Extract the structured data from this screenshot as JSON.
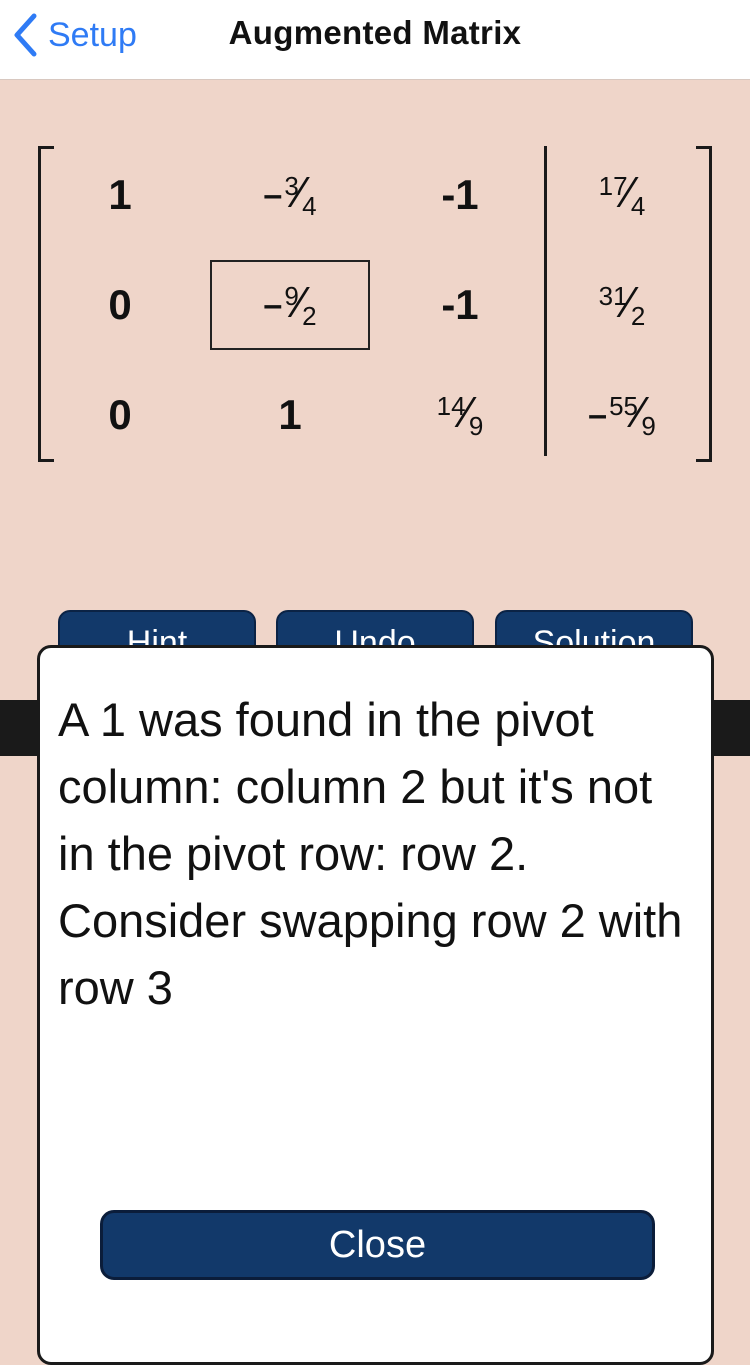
{
  "navbar": {
    "back_label": "Setup",
    "title": "Augmented Matrix"
  },
  "matrix": {
    "pivot_cell": {
      "row": 2,
      "col": 2
    },
    "rows": [
      [
        {
          "kind": "int",
          "text": "1"
        },
        {
          "kind": "frac",
          "neg": "-",
          "num": "3",
          "den": "4"
        },
        {
          "kind": "int",
          "text": "-1"
        },
        {
          "kind": "frac",
          "neg": "",
          "num": "17",
          "den": "4"
        }
      ],
      [
        {
          "kind": "int",
          "text": "0"
        },
        {
          "kind": "frac",
          "neg": "-",
          "num": "9",
          "den": "2"
        },
        {
          "kind": "int",
          "text": "-1"
        },
        {
          "kind": "frac",
          "neg": "",
          "num": "31",
          "den": "2"
        }
      ],
      [
        {
          "kind": "int",
          "text": "0"
        },
        {
          "kind": "int",
          "text": "1"
        },
        {
          "kind": "frac",
          "neg": "",
          "num": "14",
          "den": "9"
        },
        {
          "kind": "frac",
          "neg": "-",
          "num": "55",
          "den": "9"
        }
      ]
    ]
  },
  "buttons": {
    "hint": "Hint",
    "undo": "Undo",
    "solution": "Solution"
  },
  "dialog": {
    "message": "A 1 was found in the pivot column: column 2 but it's not in the pivot row: row 2. Consider swapping row 2 with row 3",
    "close_label": "Close"
  }
}
